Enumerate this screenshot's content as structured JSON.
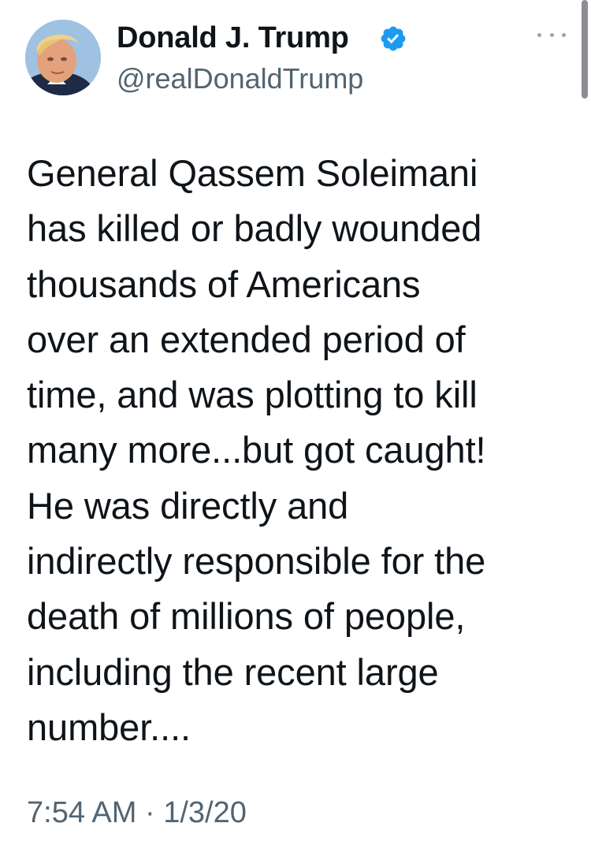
{
  "tweet": {
    "author": {
      "display_name": "Donald J. Trump",
      "handle": "@realDonaldTrump",
      "verified": true
    },
    "text_lines": [
      "General Qassem Soleimani",
      "has killed or badly wounded",
      "thousands of Americans",
      "over an extended period of",
      "time, and was plotting to kill",
      "many more...but got caught!",
      "He was directly and",
      "indirectly responsible for the",
      "death of millions of people,",
      "including the recent large",
      "number...."
    ],
    "time": "7:54 AM",
    "separator": "·",
    "date": "1/3/20"
  },
  "icons": {
    "verified": "verified-badge-icon",
    "more": "more-options-icon"
  },
  "colors": {
    "text": "#0f1419",
    "secondary": "#536471",
    "verified_blue": "#1d9bf0",
    "background": "#ffffff"
  }
}
